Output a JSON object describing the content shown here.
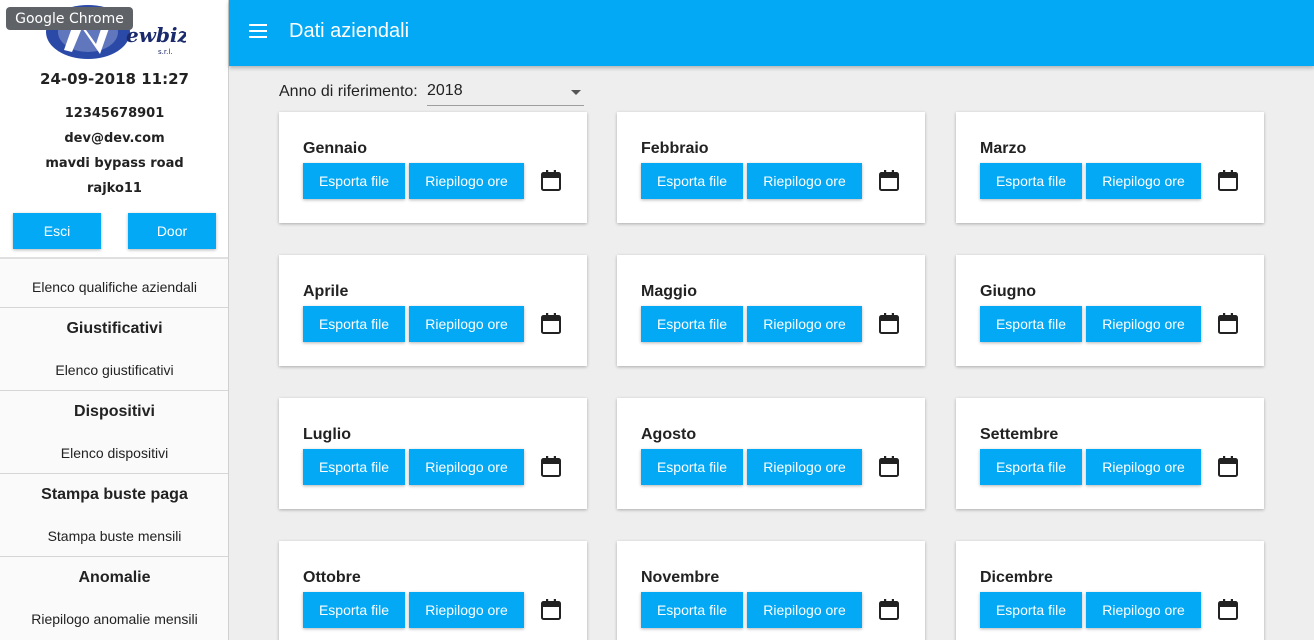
{
  "tooltip": "Google Chrome",
  "brand": {
    "logo_text": "ewbiz",
    "logo_subtext": "s.r.l.",
    "logo_color": "#1a3a8f"
  },
  "sidebar": {
    "datetime": "24-09-2018 11:27",
    "user": {
      "code": "12345678901",
      "email": "dev@dev.com",
      "address": "mavdi bypass road",
      "username": "rajko11"
    },
    "buttons": {
      "exit": "Esci",
      "door": "Door"
    },
    "menu": {
      "qualifiche": "Elenco qualifiche aziendali",
      "giustificativi_title": "Giustificativi",
      "giustificativi_item": "Elenco giustificativi",
      "dispositivi_title": "Dispositivi",
      "dispositivi_item": "Elenco dispositivi",
      "stampa_title": "Stampa buste paga",
      "stampa_item": "Stampa buste mensili",
      "anomalie_title": "Anomalie",
      "anomalie_item": "Riepilogo anomalie mensili"
    }
  },
  "appbar": {
    "title": "Dati aziendali",
    "menu_icon": "menu-icon"
  },
  "year_selector": {
    "label": "Anno di riferimento:",
    "value": "2018"
  },
  "months": [
    {
      "name": "Gennaio"
    },
    {
      "name": "Febbraio"
    },
    {
      "name": "Marzo"
    },
    {
      "name": "Aprile"
    },
    {
      "name": "Maggio"
    },
    {
      "name": "Giugno"
    },
    {
      "name": "Luglio"
    },
    {
      "name": "Agosto"
    },
    {
      "name": "Settembre"
    },
    {
      "name": "Ottobre"
    },
    {
      "name": "Novembre"
    },
    {
      "name": "Dicembre"
    }
  ],
  "card_actions": {
    "export": "Esporta file",
    "summary": "Riepilogo ore",
    "calendar_icon": "calendar-icon"
  },
  "colors": {
    "primary": "#03a9f4",
    "background": "#eeeeee",
    "sidebar": "#fafafa"
  }
}
